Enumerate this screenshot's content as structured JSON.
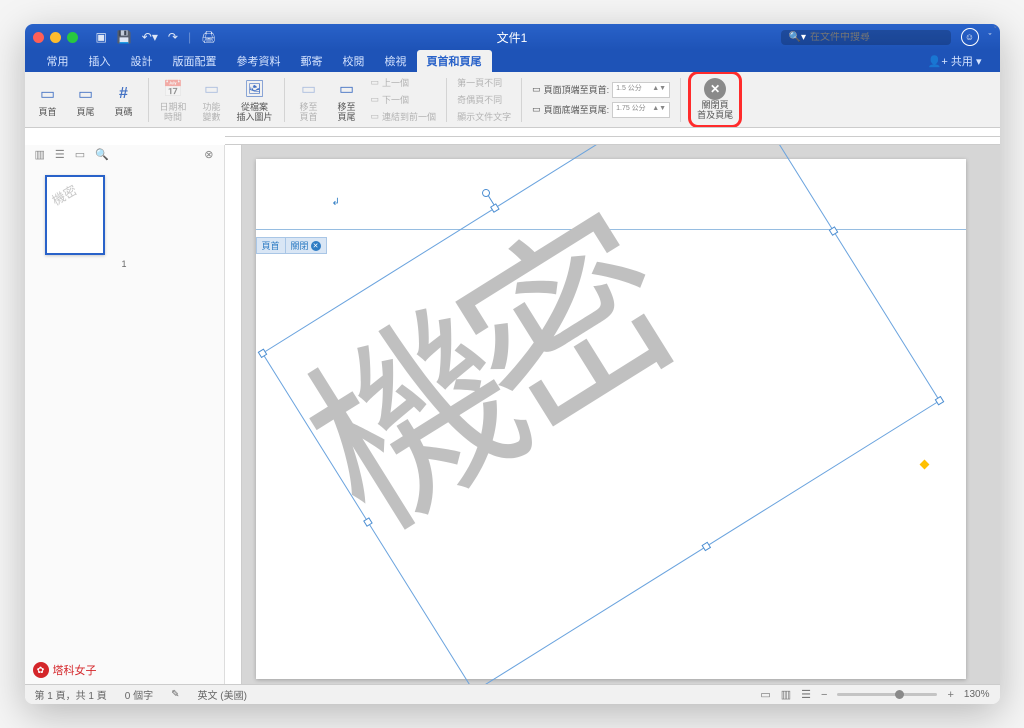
{
  "titlebar": {
    "title": "文件1",
    "search_placeholder": "在文件中搜尋"
  },
  "tabs": {
    "items": [
      "常用",
      "插入",
      "設計",
      "版面配置",
      "參考資料",
      "郵寄",
      "校閱",
      "檢視",
      "頁首和頁尾"
    ],
    "share": "共用"
  },
  "ribbon": {
    "header": "頁首",
    "footer": "頁尾",
    "pagenum": "頁碼",
    "datetime": "日期和\n時間",
    "vars": "功能\n變數",
    "frompic": "從檔案\n插入圖片",
    "goto_h": "移至\n頁首",
    "goto_f": "移至\n頁尾",
    "prev": "上一個",
    "next": "下一個",
    "linkprev": "連結到前一個",
    "firstdiff": "第一頁不同",
    "oddeven": "奇偶頁不同",
    "showtxt": "顯示文件文字",
    "topdist_lbl": "頁面頂端至頁首:",
    "topdist_val": "1.5 公分",
    "botdist_lbl": "頁面底端至頁尾:",
    "botdist_val": "1.75 公分",
    "close": "關閉頁\n首及頁尾"
  },
  "thumb": {
    "num": "1",
    "watermark": "機密"
  },
  "page": {
    "watermark": "機密",
    "tag_header": "頁首",
    "tag_close": "關閉"
  },
  "status": {
    "pages": "第 1 頁，共 1 頁",
    "words": "0 個字",
    "lang": "英文 (美國)",
    "zoom": "130%"
  },
  "brand": "塔科女子"
}
